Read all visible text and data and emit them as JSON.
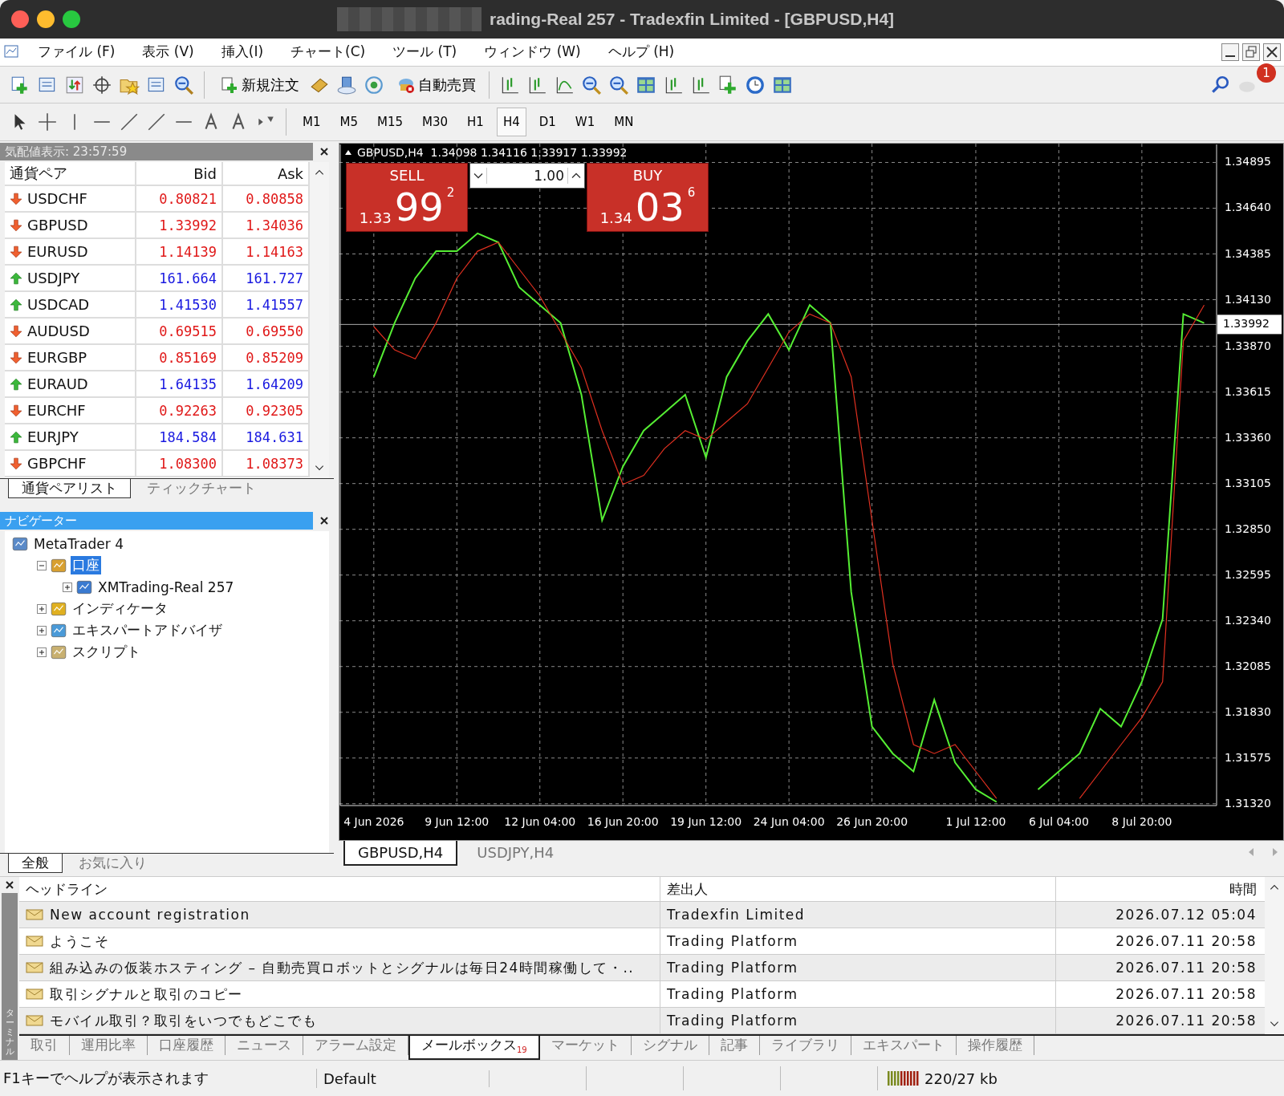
{
  "window": {
    "title": "rading-Real 257 - Tradexfin Limited - [GBPUSD,H4]"
  },
  "menu": [
    "ファイル (F)",
    "表示 (V)",
    "挿入(I)",
    "チャート(C)",
    "ツール (T)",
    "ウィンドウ (W)",
    "ヘルプ (H)"
  ],
  "toolbar": {
    "new_order": "新規注文",
    "auto_trading": "自動売買",
    "notifications": "1"
  },
  "timeframes": [
    {
      "label": "M1",
      "selected": false
    },
    {
      "label": "M5",
      "selected": false
    },
    {
      "label": "M15",
      "selected": false
    },
    {
      "label": "M30",
      "selected": false
    },
    {
      "label": "H1",
      "selected": false
    },
    {
      "label": "H4",
      "selected": true
    },
    {
      "label": "D1",
      "selected": false
    },
    {
      "label": "W1",
      "selected": false
    },
    {
      "label": "MN",
      "selected": false
    }
  ],
  "market_watch": {
    "title": "気配値表示: 23:57:59",
    "columns": [
      "通貨ペア",
      "Bid",
      "Ask"
    ],
    "rows": [
      {
        "symbol": "USDCHF",
        "up": false,
        "bid": "0.80821",
        "ask": "0.80858"
      },
      {
        "symbol": "GBPUSD",
        "up": false,
        "bid": "1.33992",
        "ask": "1.34036"
      },
      {
        "symbol": "EURUSD",
        "up": false,
        "bid": "1.14139",
        "ask": "1.14163"
      },
      {
        "symbol": "USDJPY",
        "up": true,
        "bid": "161.664",
        "ask": "161.727"
      },
      {
        "symbol": "USDCAD",
        "up": true,
        "bid": "1.41530",
        "ask": "1.41557"
      },
      {
        "symbol": "AUDUSD",
        "up": false,
        "bid": "0.69515",
        "ask": "0.69550"
      },
      {
        "symbol": "EURGBP",
        "up": false,
        "bid": "0.85169",
        "ask": "0.85209"
      },
      {
        "symbol": "EURAUD",
        "up": true,
        "bid": "1.64135",
        "ask": "1.64209"
      },
      {
        "symbol": "EURCHF",
        "up": false,
        "bid": "0.92263",
        "ask": "0.92305"
      },
      {
        "symbol": "EURJPY",
        "up": true,
        "bid": "184.584",
        "ask": "184.631"
      },
      {
        "symbol": "GBPCHF",
        "up": false,
        "bid": "1.08300",
        "ask": "1.08373"
      }
    ],
    "tabs": [
      {
        "label": "通貨ペアリスト",
        "selected": true
      },
      {
        "label": "ティックチャート",
        "selected": false
      }
    ]
  },
  "navigator": {
    "title": "ナビゲーター",
    "tree": [
      {
        "label": "MetaTrader 4",
        "kind": "app",
        "children": [
          {
            "label": "口座",
            "kind": "accounts",
            "expanded": true,
            "selected": true,
            "children": [
              {
                "label": "XMTrading-Real 257",
                "kind": "server",
                "expanded": false,
                "selected": false
              }
            ]
          },
          {
            "label": "インディケータ",
            "kind": "indicators",
            "expanded": false,
            "selected": false
          },
          {
            "label": "エキスパートアドバイザ",
            "kind": "experts",
            "expanded": false,
            "selected": false
          },
          {
            "label": "スクリプト",
            "kind": "scripts",
            "expanded": false,
            "selected": false
          }
        ]
      }
    ],
    "tabs": [
      {
        "label": "全般",
        "selected": true
      },
      {
        "label": "お気に入り",
        "selected": false
      }
    ]
  },
  "chart": {
    "header": "GBPUSD,H4  1.34098 1.34116 1.33917 1.33992",
    "trade_panel": {
      "sell": "SELL",
      "buy": "BUY",
      "lot": "1.00",
      "sell_price": {
        "big": "1.33",
        "main": "99",
        "small": "2"
      },
      "buy_price": {
        "big": "1.34",
        "main": "03",
        "small": "6"
      }
    },
    "chart_data": {
      "type": "line",
      "grid": true,
      "categories": [
        "4 Jun 2026",
        null,
        null,
        null,
        "9 Jun 12:00",
        null,
        null,
        null,
        "12 Jun 04:00",
        null,
        null,
        null,
        "16 Jun 20:00",
        null,
        null,
        null,
        "19 Jun 12:00",
        null,
        null,
        null,
        "24 Jun 04:00",
        null,
        null,
        null,
        "26 Jun 20:00",
        null,
        null,
        null,
        null,
        "1 Jul 12:00",
        null,
        null,
        null,
        "6 Jul 04:00",
        null,
        null,
        null,
        "8 Jul 20:00",
        null,
        null,
        null
      ],
      "ylim": [
        1.3131,
        1.35
      ],
      "yticks": [
        {
          "value": 1.34895,
          "label": "1.34895"
        },
        {
          "value": 1.3464,
          "label": "1.34640"
        },
        {
          "value": 1.34385,
          "label": "1.34385"
        },
        {
          "value": 1.3413,
          "label": "1.34130"
        },
        {
          "value": 1.3387,
          "label": "1.33870"
        },
        {
          "value": 1.33615,
          "label": "1.33615"
        },
        {
          "value": 1.3336,
          "label": "1.33360"
        },
        {
          "value": 1.33105,
          "label": "1.33105"
        },
        {
          "value": 1.3285,
          "label": "1.32850"
        },
        {
          "value": 1.32595,
          "label": "1.32595"
        },
        {
          "value": 1.3234,
          "label": "1.32340"
        },
        {
          "value": 1.32085,
          "label": "1.32085"
        },
        {
          "value": 1.3183,
          "label": "1.31830"
        },
        {
          "value": 1.31575,
          "label": "1.31575"
        },
        {
          "value": 1.3132,
          "label": "1.31320"
        }
      ],
      "ref_lines": [
        {
          "axis": "y",
          "value": 1.33992,
          "label": "1.33992"
        }
      ],
      "series": [
        {
          "color": "#55ee33",
          "values": [
            1.337,
            1.34,
            1.3425,
            1.344,
            1.344,
            1.345,
            1.3445,
            1.342,
            1.341,
            1.34,
            1.336,
            1.329,
            1.332,
            1.334,
            1.335,
            1.336,
            1.3325,
            1.337,
            1.339,
            1.3405,
            1.3385,
            1.341,
            1.34,
            1.325,
            1.3175,
            1.316,
            1.315,
            1.319,
            1.3155,
            1.314,
            1.3133,
            null,
            1.314,
            1.315,
            1.316,
            1.3185,
            1.3175,
            1.32,
            1.3235,
            1.3405,
            1.34
          ]
        },
        {
          "color": "#e03020",
          "values": [
            1.3398,
            1.3385,
            1.338,
            1.34,
            1.3425,
            1.344,
            1.3445,
            1.343,
            1.3415,
            1.3395,
            1.3375,
            1.334,
            1.331,
            1.3315,
            1.333,
            1.334,
            1.3335,
            1.3345,
            1.3355,
            1.3375,
            1.3395,
            1.3405,
            1.34,
            1.337,
            1.329,
            1.321,
            1.3165,
            1.316,
            1.3165,
            1.315,
            1.3135,
            null,
            null,
            null,
            1.3135,
            1.315,
            1.3165,
            1.318,
            1.32,
            1.339,
            1.341
          ]
        }
      ]
    }
  },
  "chart_tabs": [
    {
      "label": "GBPUSD,H4",
      "selected": true
    },
    {
      "label": "USDJPY,H4",
      "selected": false
    }
  ],
  "terminal": {
    "side_label": "ターミナル",
    "columns": [
      "ヘッドライン",
      "差出人",
      "時間"
    ],
    "rows": [
      {
        "headline": "New account registration",
        "from": "Tradexfin Limited",
        "time": "2026.07.12 05:04"
      },
      {
        "headline": "ようこそ",
        "from": "Trading Platform",
        "time": "2026.07.11 20:58"
      },
      {
        "headline": "組み込みの仮装ホスティング – 自動売買ロボットとシグナルは毎日24時間稼働して・..",
        "from": "Trading Platform",
        "time": "2026.07.11 20:58"
      },
      {
        "headline": "取引シグナルと取引のコピー",
        "from": "Trading Platform",
        "time": "2026.07.11 20:58"
      },
      {
        "headline": "モバイル取引？取引をいつでもどこでも",
        "from": "Trading Platform",
        "time": "2026.07.11 20:58"
      }
    ],
    "tabs": [
      {
        "label": "取引",
        "selected": false
      },
      {
        "label": "運用比率",
        "selected": false
      },
      {
        "label": "口座履歴",
        "selected": false
      },
      {
        "label": "ニュース",
        "selected": false
      },
      {
        "label": "アラーム設定",
        "selected": false
      },
      {
        "label": "メールボックス",
        "selected": true,
        "badge": "19"
      },
      {
        "label": "マーケット",
        "selected": false
      },
      {
        "label": "シグナル",
        "selected": false
      },
      {
        "label": "記事",
        "selected": false
      },
      {
        "label": "ライブラリ",
        "selected": false
      },
      {
        "label": "エキスパート",
        "selected": false
      },
      {
        "label": "操作履歴",
        "selected": false
      }
    ]
  },
  "status_bar": {
    "help": "F1キーでヘルプが表示されます",
    "profile": "Default",
    "traffic": "220/27 kb"
  }
}
